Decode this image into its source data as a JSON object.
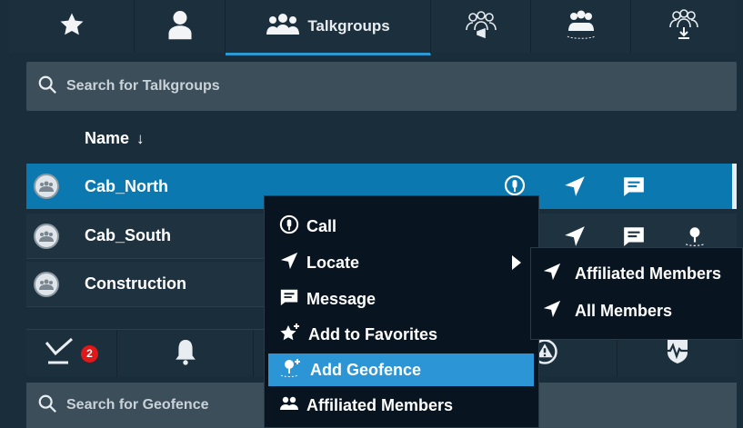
{
  "tabs": [
    {
      "icon": "star-icon"
    },
    {
      "icon": "person-icon"
    },
    {
      "icon": "talkgroup-icon",
      "label": "Talkgroups"
    },
    {
      "icon": "group-broadcast-icon"
    },
    {
      "icon": "group-dispatch-icon"
    },
    {
      "icon": "group-download-icon"
    }
  ],
  "search": {
    "placeholder": "Search for Talkgroups"
  },
  "list": {
    "column_header": "Name",
    "sort_indicator": "↓",
    "rows": [
      {
        "name": "Cab_North",
        "selected": true
      },
      {
        "name": "Cab_South",
        "selected": false
      },
      {
        "name": "Construction",
        "selected": false
      }
    ]
  },
  "bottom_tabs": {
    "inbox_badge": "2"
  },
  "search2": {
    "placeholder": "Search for Geofence"
  },
  "context_menu": {
    "items": [
      {
        "label": "Call",
        "icon": "ptt-call-icon"
      },
      {
        "label": "Locate",
        "icon": "locate-arrow-icon",
        "has_submenu": true
      },
      {
        "label": "Message",
        "icon": "message-icon"
      },
      {
        "label": "Add to Favorites",
        "icon": "star-plus-icon"
      },
      {
        "label": "Add Geofence",
        "icon": "geofence-add-icon",
        "highlighted": true
      },
      {
        "label": "Affiliated Members",
        "icon": "members-icon"
      }
    ]
  },
  "submenu": {
    "items": [
      {
        "label": "Affiliated Members",
        "icon": "locate-arrow-icon"
      },
      {
        "label": "All Members",
        "icon": "locate-arrow-icon"
      }
    ]
  },
  "colors": {
    "background": "#1a2d3b",
    "selected_row": "#0b78b0",
    "menu_highlight": "#2b95d6",
    "tab_underline": "#2d9ad3",
    "badge": "#e01818"
  }
}
